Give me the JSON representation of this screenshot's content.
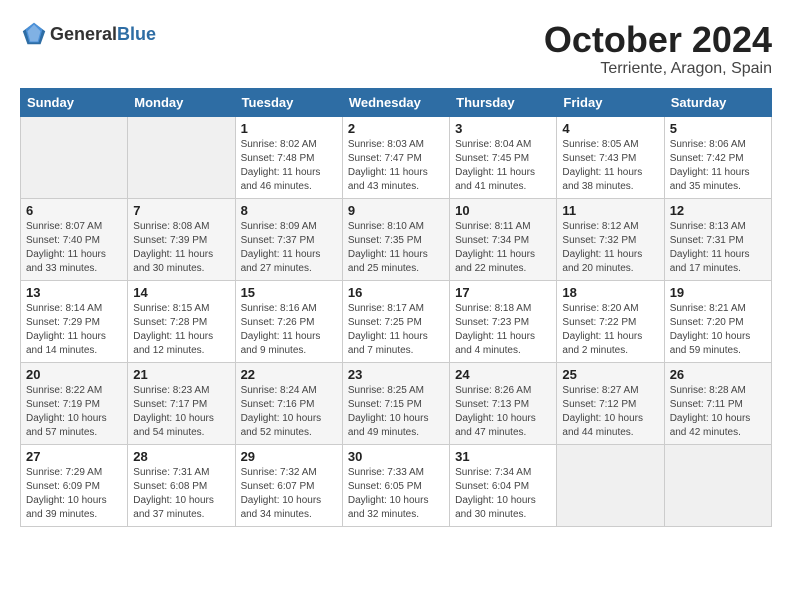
{
  "header": {
    "logo_general": "General",
    "logo_blue": "Blue",
    "month": "October 2024",
    "location": "Terriente, Aragon, Spain"
  },
  "days_of_week": [
    "Sunday",
    "Monday",
    "Tuesday",
    "Wednesday",
    "Thursday",
    "Friday",
    "Saturday"
  ],
  "weeks": [
    [
      {
        "day": "",
        "sunrise": "",
        "sunset": "",
        "daylight": ""
      },
      {
        "day": "",
        "sunrise": "",
        "sunset": "",
        "daylight": ""
      },
      {
        "day": "1",
        "sunrise": "Sunrise: 8:02 AM",
        "sunset": "Sunset: 7:48 PM",
        "daylight": "Daylight: 11 hours and 46 minutes."
      },
      {
        "day": "2",
        "sunrise": "Sunrise: 8:03 AM",
        "sunset": "Sunset: 7:47 PM",
        "daylight": "Daylight: 11 hours and 43 minutes."
      },
      {
        "day": "3",
        "sunrise": "Sunrise: 8:04 AM",
        "sunset": "Sunset: 7:45 PM",
        "daylight": "Daylight: 11 hours and 41 minutes."
      },
      {
        "day": "4",
        "sunrise": "Sunrise: 8:05 AM",
        "sunset": "Sunset: 7:43 PM",
        "daylight": "Daylight: 11 hours and 38 minutes."
      },
      {
        "day": "5",
        "sunrise": "Sunrise: 8:06 AM",
        "sunset": "Sunset: 7:42 PM",
        "daylight": "Daylight: 11 hours and 35 minutes."
      }
    ],
    [
      {
        "day": "6",
        "sunrise": "Sunrise: 8:07 AM",
        "sunset": "Sunset: 7:40 PM",
        "daylight": "Daylight: 11 hours and 33 minutes."
      },
      {
        "day": "7",
        "sunrise": "Sunrise: 8:08 AM",
        "sunset": "Sunset: 7:39 PM",
        "daylight": "Daylight: 11 hours and 30 minutes."
      },
      {
        "day": "8",
        "sunrise": "Sunrise: 8:09 AM",
        "sunset": "Sunset: 7:37 PM",
        "daylight": "Daylight: 11 hours and 27 minutes."
      },
      {
        "day": "9",
        "sunrise": "Sunrise: 8:10 AM",
        "sunset": "Sunset: 7:35 PM",
        "daylight": "Daylight: 11 hours and 25 minutes."
      },
      {
        "day": "10",
        "sunrise": "Sunrise: 8:11 AM",
        "sunset": "Sunset: 7:34 PM",
        "daylight": "Daylight: 11 hours and 22 minutes."
      },
      {
        "day": "11",
        "sunrise": "Sunrise: 8:12 AM",
        "sunset": "Sunset: 7:32 PM",
        "daylight": "Daylight: 11 hours and 20 minutes."
      },
      {
        "day": "12",
        "sunrise": "Sunrise: 8:13 AM",
        "sunset": "Sunset: 7:31 PM",
        "daylight": "Daylight: 11 hours and 17 minutes."
      }
    ],
    [
      {
        "day": "13",
        "sunrise": "Sunrise: 8:14 AM",
        "sunset": "Sunset: 7:29 PM",
        "daylight": "Daylight: 11 hours and 14 minutes."
      },
      {
        "day": "14",
        "sunrise": "Sunrise: 8:15 AM",
        "sunset": "Sunset: 7:28 PM",
        "daylight": "Daylight: 11 hours and 12 minutes."
      },
      {
        "day": "15",
        "sunrise": "Sunrise: 8:16 AM",
        "sunset": "Sunset: 7:26 PM",
        "daylight": "Daylight: 11 hours and 9 minutes."
      },
      {
        "day": "16",
        "sunrise": "Sunrise: 8:17 AM",
        "sunset": "Sunset: 7:25 PM",
        "daylight": "Daylight: 11 hours and 7 minutes."
      },
      {
        "day": "17",
        "sunrise": "Sunrise: 8:18 AM",
        "sunset": "Sunset: 7:23 PM",
        "daylight": "Daylight: 11 hours and 4 minutes."
      },
      {
        "day": "18",
        "sunrise": "Sunrise: 8:20 AM",
        "sunset": "Sunset: 7:22 PM",
        "daylight": "Daylight: 11 hours and 2 minutes."
      },
      {
        "day": "19",
        "sunrise": "Sunrise: 8:21 AM",
        "sunset": "Sunset: 7:20 PM",
        "daylight": "Daylight: 10 hours and 59 minutes."
      }
    ],
    [
      {
        "day": "20",
        "sunrise": "Sunrise: 8:22 AM",
        "sunset": "Sunset: 7:19 PM",
        "daylight": "Daylight: 10 hours and 57 minutes."
      },
      {
        "day": "21",
        "sunrise": "Sunrise: 8:23 AM",
        "sunset": "Sunset: 7:17 PM",
        "daylight": "Daylight: 10 hours and 54 minutes."
      },
      {
        "day": "22",
        "sunrise": "Sunrise: 8:24 AM",
        "sunset": "Sunset: 7:16 PM",
        "daylight": "Daylight: 10 hours and 52 minutes."
      },
      {
        "day": "23",
        "sunrise": "Sunrise: 8:25 AM",
        "sunset": "Sunset: 7:15 PM",
        "daylight": "Daylight: 10 hours and 49 minutes."
      },
      {
        "day": "24",
        "sunrise": "Sunrise: 8:26 AM",
        "sunset": "Sunset: 7:13 PM",
        "daylight": "Daylight: 10 hours and 47 minutes."
      },
      {
        "day": "25",
        "sunrise": "Sunrise: 8:27 AM",
        "sunset": "Sunset: 7:12 PM",
        "daylight": "Daylight: 10 hours and 44 minutes."
      },
      {
        "day": "26",
        "sunrise": "Sunrise: 8:28 AM",
        "sunset": "Sunset: 7:11 PM",
        "daylight": "Daylight: 10 hours and 42 minutes."
      }
    ],
    [
      {
        "day": "27",
        "sunrise": "Sunrise: 7:29 AM",
        "sunset": "Sunset: 6:09 PM",
        "daylight": "Daylight: 10 hours and 39 minutes."
      },
      {
        "day": "28",
        "sunrise": "Sunrise: 7:31 AM",
        "sunset": "Sunset: 6:08 PM",
        "daylight": "Daylight: 10 hours and 37 minutes."
      },
      {
        "day": "29",
        "sunrise": "Sunrise: 7:32 AM",
        "sunset": "Sunset: 6:07 PM",
        "daylight": "Daylight: 10 hours and 34 minutes."
      },
      {
        "day": "30",
        "sunrise": "Sunrise: 7:33 AM",
        "sunset": "Sunset: 6:05 PM",
        "daylight": "Daylight: 10 hours and 32 minutes."
      },
      {
        "day": "31",
        "sunrise": "Sunrise: 7:34 AM",
        "sunset": "Sunset: 6:04 PM",
        "daylight": "Daylight: 10 hours and 30 minutes."
      },
      {
        "day": "",
        "sunrise": "",
        "sunset": "",
        "daylight": ""
      },
      {
        "day": "",
        "sunrise": "",
        "sunset": "",
        "daylight": ""
      }
    ]
  ]
}
